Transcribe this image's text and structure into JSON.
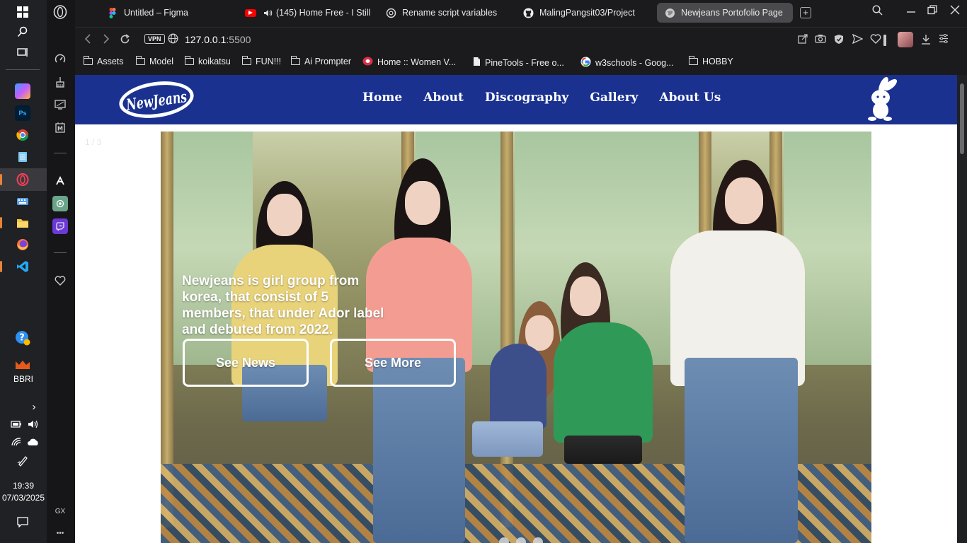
{
  "taskbar": {
    "time": "19:39",
    "date": "07/03/2025",
    "bbri_label": "BBRI",
    "icons": [
      "windows-start-icon",
      "search-icon",
      "task-view-icon",
      "copilot-icon",
      "photoshop-icon",
      "chrome-icon",
      "notepad-icon",
      "opera-gx-icon",
      "keyboard-icon",
      "file-explorer-icon",
      "firefox-icon",
      "vscode-icon",
      "help-icon",
      "bbri-icon",
      "chevron-right-icon",
      "battery-icon",
      "volume-icon",
      "wifi-icon",
      "onedrive-icon",
      "pen-icon",
      "notification-icon"
    ]
  },
  "sidebar": {
    "gx_label": "GX",
    "more_label": "•••"
  },
  "tabs": [
    {
      "label": "Untitled – Figma",
      "icon": "figma-icon"
    },
    {
      "label": "(145) Home Free - I Still",
      "icon": "youtube-icon"
    },
    {
      "label": "Rename script variables",
      "icon": "chatgpt-icon"
    },
    {
      "label": "MalingPangsit03/Project",
      "icon": "github-icon"
    },
    {
      "label": "Newjeans Portofolio Page",
      "icon": "globe-icon",
      "active": true
    }
  ],
  "address": {
    "vpn": "VPN",
    "host": "127.0.0.1",
    "port": ":5500"
  },
  "bookmarks": [
    {
      "label": "Assets",
      "icon": "folder"
    },
    {
      "label": "Model",
      "icon": "folder"
    },
    {
      "label": "koikatsu",
      "icon": "folder"
    },
    {
      "label": "FUN!!!",
      "icon": "folder"
    },
    {
      "label": "Ai Prompter",
      "icon": "folder"
    },
    {
      "label": "Home :: Women V...",
      "icon": "site"
    },
    {
      "label": "PineTools - Free o...",
      "icon": "page"
    },
    {
      "label": "w3schools - Goog...",
      "icon": "google"
    },
    {
      "label": "HOBBY",
      "icon": "folder"
    }
  ],
  "site": {
    "nav": {
      "links": [
        "Home",
        "About",
        "Discography",
        "Gallery",
        "About Us"
      ],
      "logo_text": "NewJeans"
    },
    "slide_counter": "1 / 3",
    "hero": {
      "text": "Newjeans is girl group from korea, that consist of 5 members, that under Ador label and debuted from 2022.",
      "buttons": [
        "See News",
        "See More"
      ]
    },
    "brand_color": "#1a3190"
  }
}
